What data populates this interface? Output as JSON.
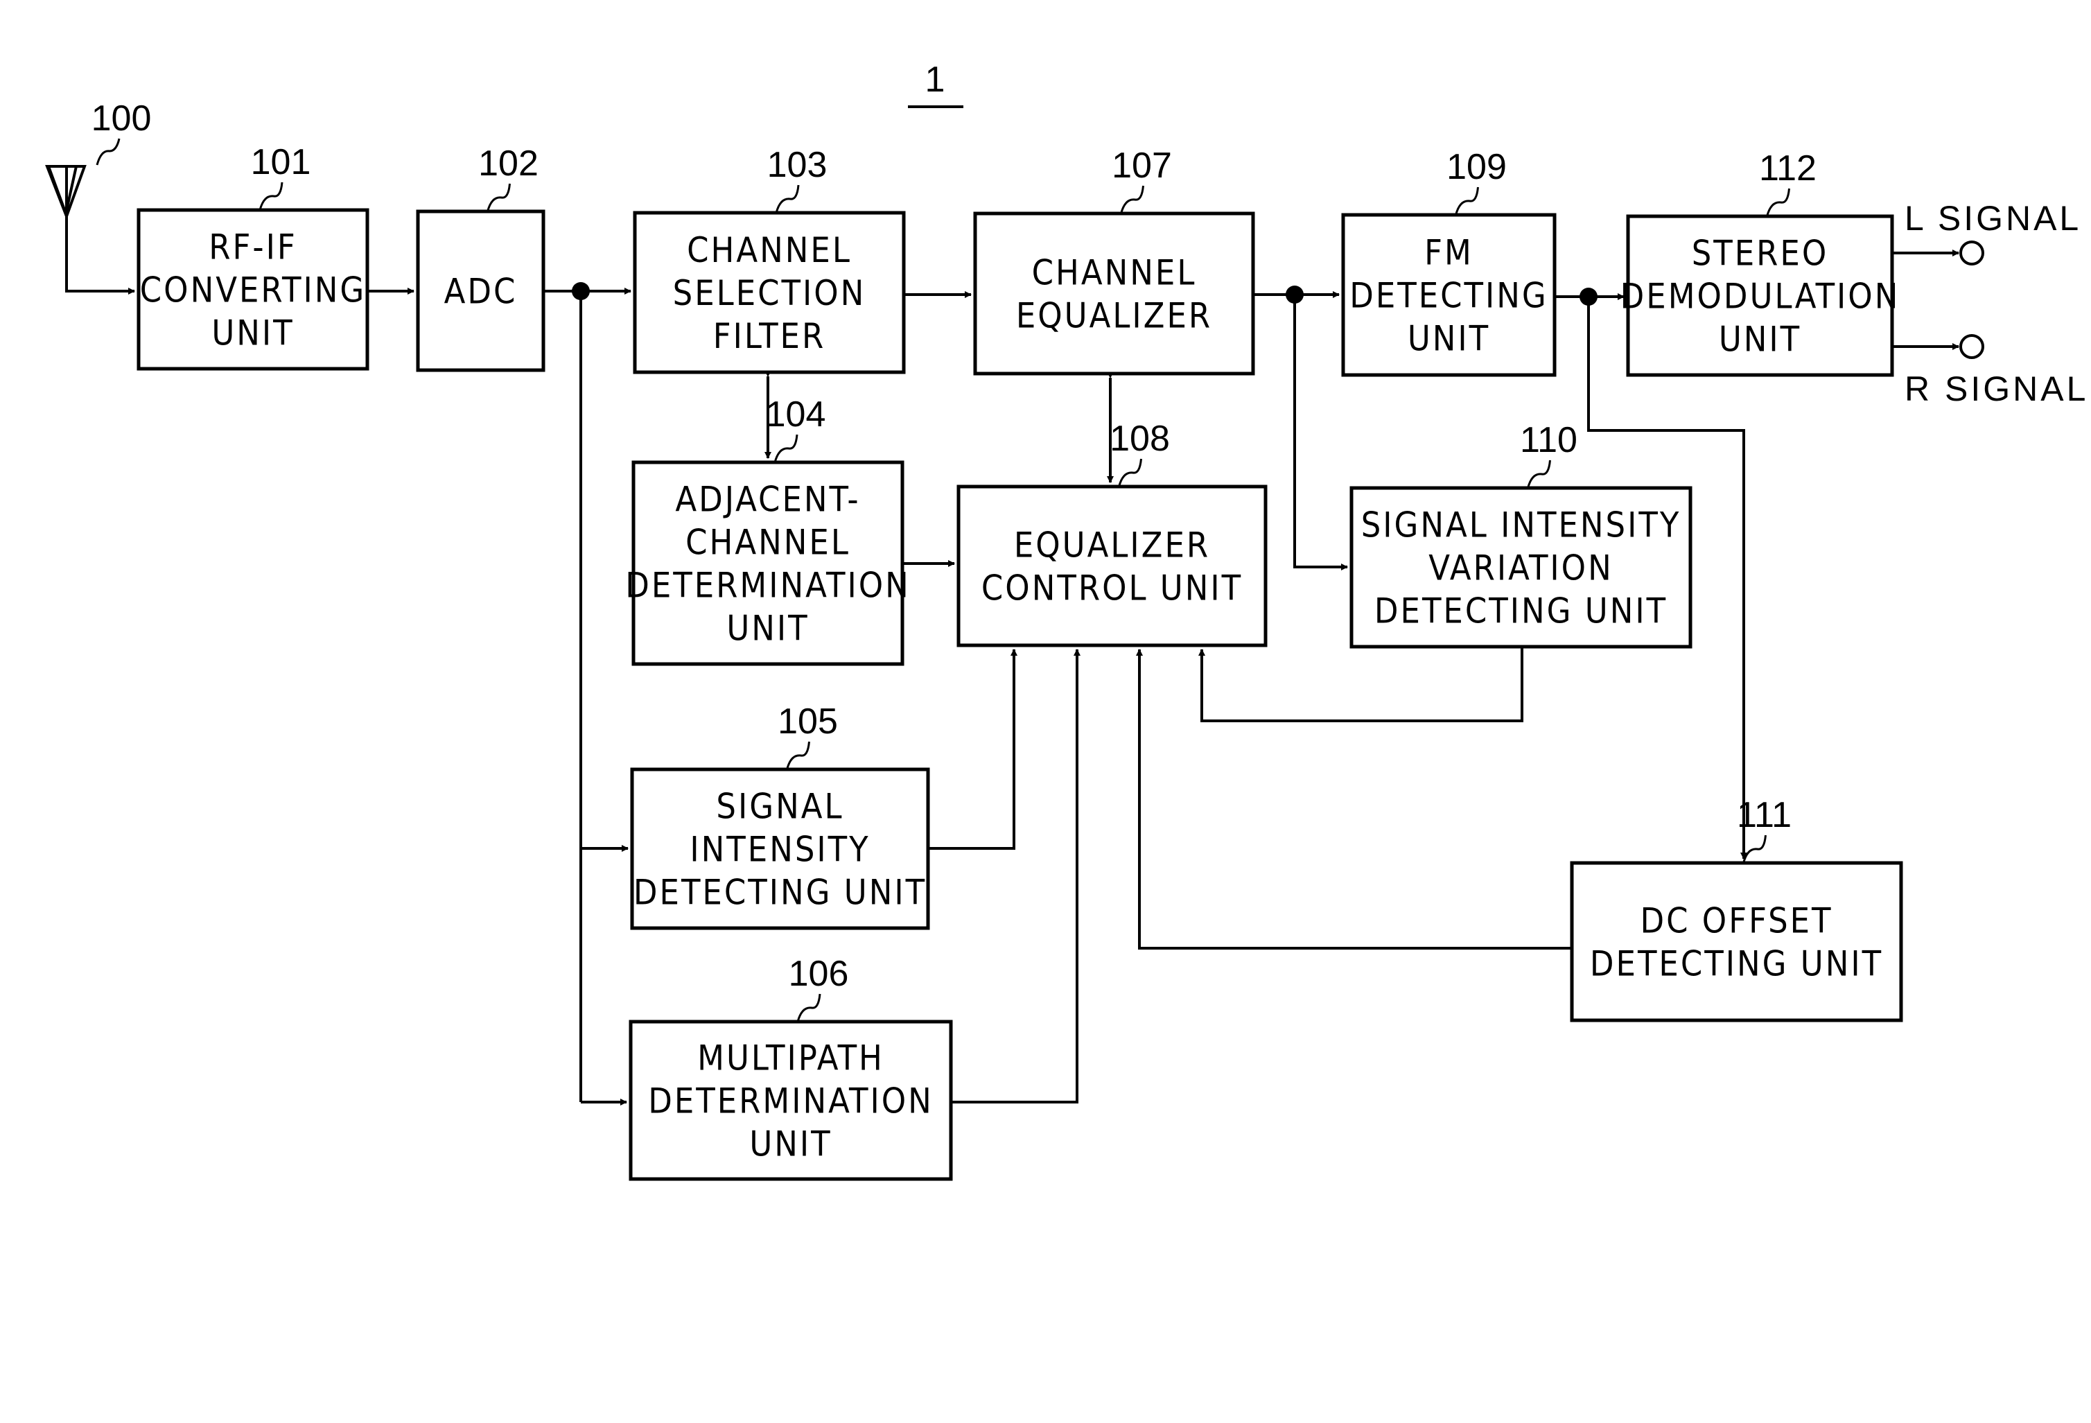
{
  "figure": {
    "reference": "1",
    "antenna_ref": "100"
  },
  "blocks": [
    {
      "id": "rfif",
      "ref": "101",
      "lines": [
        "RF-IF",
        "CONVERTING",
        "UNIT"
      ]
    },
    {
      "id": "adc",
      "ref": "102",
      "lines": [
        "ADC"
      ]
    },
    {
      "id": "chsel",
      "ref": "103",
      "lines": [
        "CHANNEL",
        "SELECTION",
        "FILTER"
      ]
    },
    {
      "id": "adjch",
      "ref": "104",
      "lines": [
        "ADJACENT-",
        "CHANNEL",
        "DETERMINATION",
        "UNIT"
      ]
    },
    {
      "id": "sigint",
      "ref": "105",
      "lines": [
        "SIGNAL",
        "INTENSITY",
        "DETECTING UNIT"
      ]
    },
    {
      "id": "multipath",
      "ref": "106",
      "lines": [
        "MULTIPATH",
        "DETERMINATION",
        "UNIT"
      ]
    },
    {
      "id": "cheq",
      "ref": "107",
      "lines": [
        "CHANNEL",
        "EQUALIZER"
      ]
    },
    {
      "id": "eqctl",
      "ref": "108",
      "lines": [
        "EQUALIZER",
        "CONTROL UNIT"
      ]
    },
    {
      "id": "fmdet",
      "ref": "109",
      "lines": [
        "FM",
        "DETECTING",
        "UNIT"
      ]
    },
    {
      "id": "sigvar",
      "ref": "110",
      "lines": [
        "SIGNAL INTENSITY",
        "VARIATION",
        "DETECTING UNIT"
      ]
    },
    {
      "id": "dcoff",
      "ref": "111",
      "lines": [
        "DC OFFSET",
        "DETECTING UNIT"
      ]
    },
    {
      "id": "stereo",
      "ref": "112",
      "lines": [
        "STEREO",
        "DEMODULATION",
        "UNIT"
      ]
    }
  ],
  "outputs": {
    "left": "L SIGNAL",
    "right": "R SIGNAL"
  },
  "connections": [
    {
      "from": "100",
      "to": "101"
    },
    {
      "from": "101",
      "to": "102"
    },
    {
      "from": "102",
      "to": "103"
    },
    {
      "from": "102",
      "to": "105"
    },
    {
      "from": "102",
      "to": "106"
    },
    {
      "from": "103",
      "to": "107"
    },
    {
      "from": "103",
      "to": "104",
      "bidirectional": true
    },
    {
      "from": "104",
      "to": "108"
    },
    {
      "from": "105",
      "to": "108"
    },
    {
      "from": "106",
      "to": "108"
    },
    {
      "from": "107",
      "to": "108",
      "bidirectional": true
    },
    {
      "from": "107",
      "to": "109"
    },
    {
      "from": "107",
      "to": "110"
    },
    {
      "from": "110",
      "to": "108"
    },
    {
      "from": "109",
      "to": "112"
    },
    {
      "from": "109",
      "to": "111"
    },
    {
      "from": "111",
      "to": "108"
    },
    {
      "from": "112",
      "to": "L SIGNAL"
    },
    {
      "from": "112",
      "to": "R SIGNAL"
    }
  ]
}
